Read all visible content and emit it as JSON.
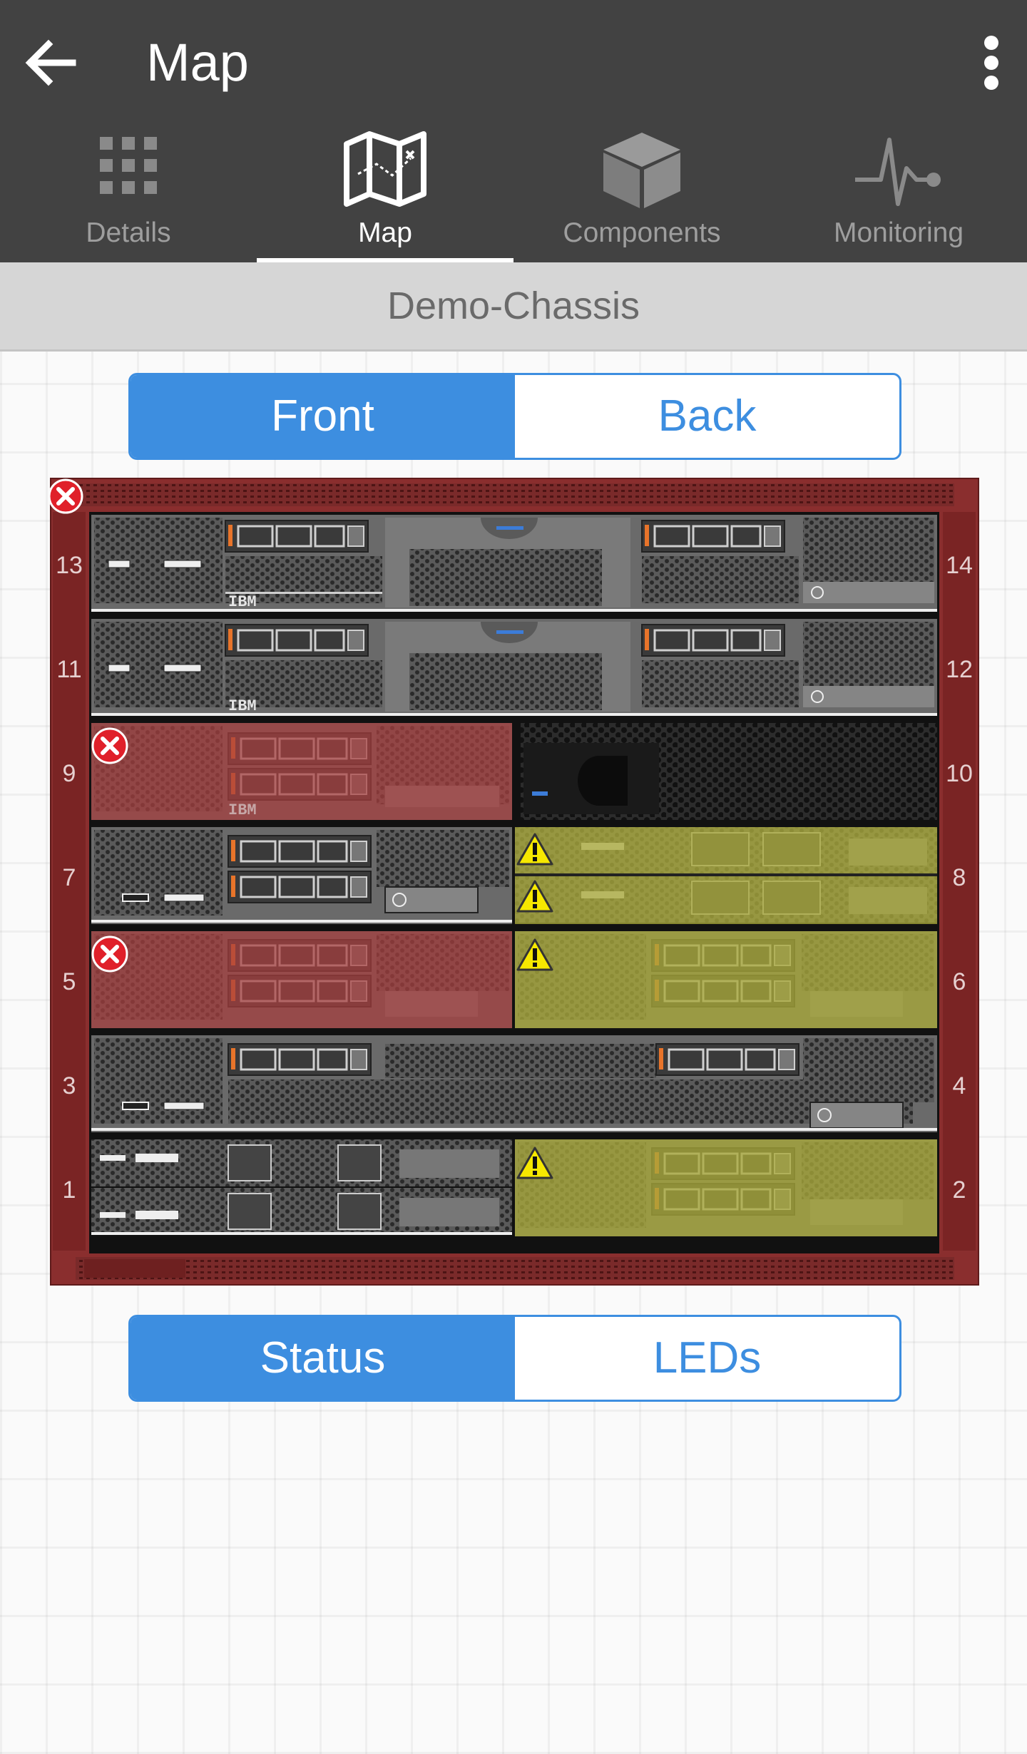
{
  "appbar": {
    "title": "Map"
  },
  "tabs": [
    {
      "label": "Details"
    },
    {
      "label": "Map"
    },
    {
      "label": "Components"
    },
    {
      "label": "Monitoring"
    }
  ],
  "active_tab": "Map",
  "subheader": {
    "title": "Demo-Chassis"
  },
  "view_toggle": {
    "options": [
      "Front",
      "Back"
    ],
    "selected": "Front"
  },
  "mode_toggle": {
    "options": [
      "Status",
      "LEDs"
    ],
    "selected": "Status"
  },
  "chassis": {
    "status": "error",
    "left_bays": [
      "13",
      "11",
      "9",
      "7",
      "5",
      "3",
      "1"
    ],
    "right_bays": [
      "14",
      "12",
      "10",
      "8",
      "6",
      "4",
      "2"
    ],
    "brand": "IBM"
  },
  "colors": {
    "appbar": "#424242",
    "accent": "#3d8ee0",
    "error": "#e0202a",
    "warning": "#f6e800",
    "error_tint": "#a83f3f",
    "warning_tint": "#a8a83a"
  }
}
